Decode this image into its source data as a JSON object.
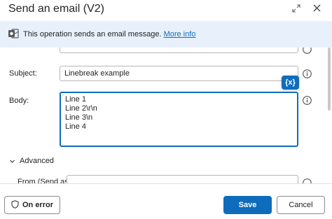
{
  "dialog": {
    "title": "Send an email (V2)"
  },
  "infobar": {
    "icon": "outlook-mail-icon",
    "message": "This operation sends an email message. ",
    "link": "More info"
  },
  "form": {
    "subject": {
      "label": "Subject:",
      "value": "Linebreak example"
    },
    "body": {
      "label": "Body:",
      "lines": [
        "Line 1",
        "Line 2\\r\\n",
        "Line 3\\n",
        "Line 4"
      ]
    },
    "dynamic_content_button": "{x}",
    "advanced_label": "Advanced",
    "from_label": "From (Send as)"
  },
  "footer": {
    "on_error": "On error",
    "save": "Save",
    "cancel": "Cancel"
  },
  "colors": {
    "accent": "#0f6cbd",
    "infobar_bg": "#e8f0fb"
  }
}
